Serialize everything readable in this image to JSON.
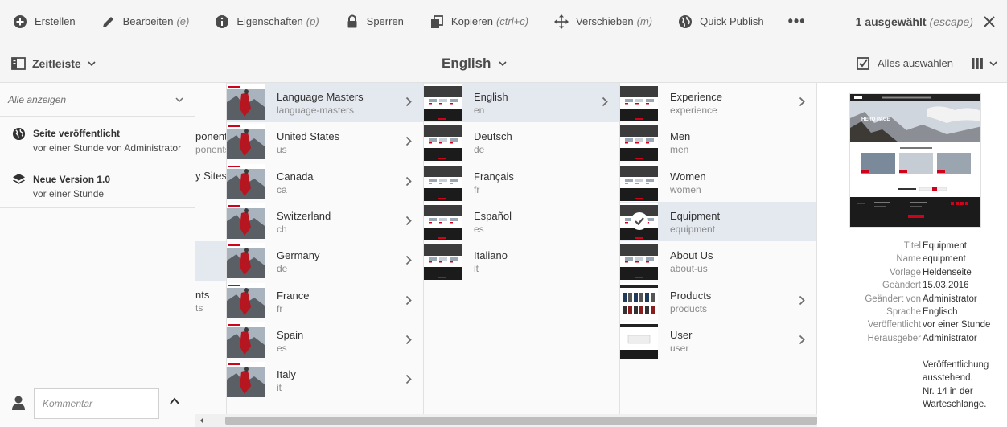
{
  "toolbar": {
    "items": [
      {
        "label": "Erstellen",
        "hint": "",
        "icon": "add-circle-icon"
      },
      {
        "label": "Bearbeiten",
        "hint": "(e)",
        "icon": "edit-pencil-icon"
      },
      {
        "label": "Eigenschaften",
        "hint": "(p)",
        "icon": "info-icon"
      },
      {
        "label": "Sperren",
        "hint": "",
        "icon": "lock-icon"
      },
      {
        "label": "Kopieren",
        "hint": "(ctrl+c)",
        "icon": "copy-icon"
      },
      {
        "label": "Verschieben",
        "hint": "(m)",
        "icon": "move-icon"
      },
      {
        "label": "Quick Publish",
        "hint": "",
        "icon": "globe-icon"
      }
    ],
    "more": "•••",
    "selection": "1 ausgewählt",
    "selection_hint": "(escape)"
  },
  "header": {
    "rail_label": "Zeitleiste",
    "title": "English",
    "select_all": "Alles auswählen"
  },
  "rail": {
    "filter": "Alle anzeigen",
    "items": [
      {
        "title": "Seite veröffentlicht",
        "sub": "vor einer Stunde von Administrator",
        "icon": "globe-icon"
      },
      {
        "title": "Neue Version 1.0",
        "sub": "vor einer Stunde",
        "icon": "layers-icon"
      }
    ],
    "comment_placeholder": "Kommentar"
  },
  "col0": {
    "fragments": [
      {
        "row": 1,
        "title": "ponents",
        "sub": "ponents"
      },
      {
        "row": 2,
        "title": "y Sites",
        "sub": ""
      },
      {
        "row": 5,
        "title": "nts",
        "sub": "ts"
      }
    ]
  },
  "col1": [
    {
      "title": "Language Masters",
      "sub": "language-masters"
    },
    {
      "title": "United States",
      "sub": "us"
    },
    {
      "title": "Canada",
      "sub": "ca"
    },
    {
      "title": "Switzerland",
      "sub": "ch"
    },
    {
      "title": "Germany",
      "sub": "de"
    },
    {
      "title": "France",
      "sub": "fr"
    },
    {
      "title": "Spain",
      "sub": "es"
    },
    {
      "title": "Italy",
      "sub": "it"
    }
  ],
  "col2": [
    {
      "title": "English",
      "sub": "en"
    },
    {
      "title": "Deutsch",
      "sub": "de"
    },
    {
      "title": "Français",
      "sub": "fr"
    },
    {
      "title": "Español",
      "sub": "es"
    },
    {
      "title": "Italiano",
      "sub": "it"
    }
  ],
  "col3": [
    {
      "title": "Experience",
      "sub": "experience"
    },
    {
      "title": "Men",
      "sub": "men"
    },
    {
      "title": "Women",
      "sub": "women"
    },
    {
      "title": "Equipment",
      "sub": "equipment"
    },
    {
      "title": "About Us",
      "sub": "about-us"
    },
    {
      "title": "Products",
      "sub": "products"
    },
    {
      "title": "User",
      "sub": "user"
    }
  ],
  "preview": {
    "meta": [
      {
        "key": "Titel",
        "value": "Equipment"
      },
      {
        "key": "Name",
        "value": "equipment"
      },
      {
        "key": "Vorlage",
        "value": "Heldenseite"
      },
      {
        "key": "Geändert",
        "value": "15.03.2016"
      },
      {
        "key": "Geändert von",
        "value": "Administrator"
      },
      {
        "key": "Sprache",
        "value": "Englisch"
      },
      {
        "key": "Veröffentlicht",
        "value": "vor einer Stunde"
      },
      {
        "key": "Herausgeber",
        "value": "Administrator"
      }
    ],
    "status_lines": [
      "Veröffentlichung",
      "ausstehend.",
      "Nr. 14 in der",
      "Warteschlange."
    ],
    "thumb_hero_text": "HERO PAGE"
  }
}
